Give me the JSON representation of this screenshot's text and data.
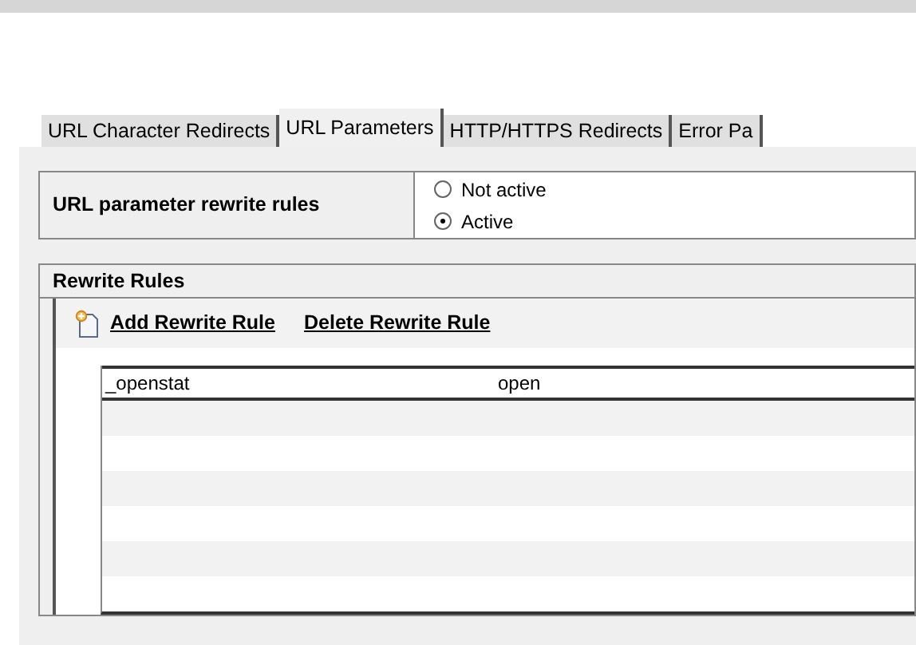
{
  "tabs": [
    {
      "label": "URL Character Redirects",
      "selected": false
    },
    {
      "label": "URL Parameters",
      "selected": true
    },
    {
      "label": "HTTP/HTTPS Redirects",
      "selected": false
    },
    {
      "label": "Error Pa",
      "selected": false
    }
  ],
  "setting": {
    "label": "URL parameter rewrite rules",
    "options": [
      {
        "label": "Not active",
        "selected": false
      },
      {
        "label": "Active",
        "selected": true
      }
    ]
  },
  "rewrite_rules": {
    "title": "Rewrite Rules",
    "actions": [
      "Add Rewrite Rule",
      "Delete Rewrite Rule"
    ],
    "rows": [
      [
        "_openstat",
        "open"
      ]
    ]
  }
}
